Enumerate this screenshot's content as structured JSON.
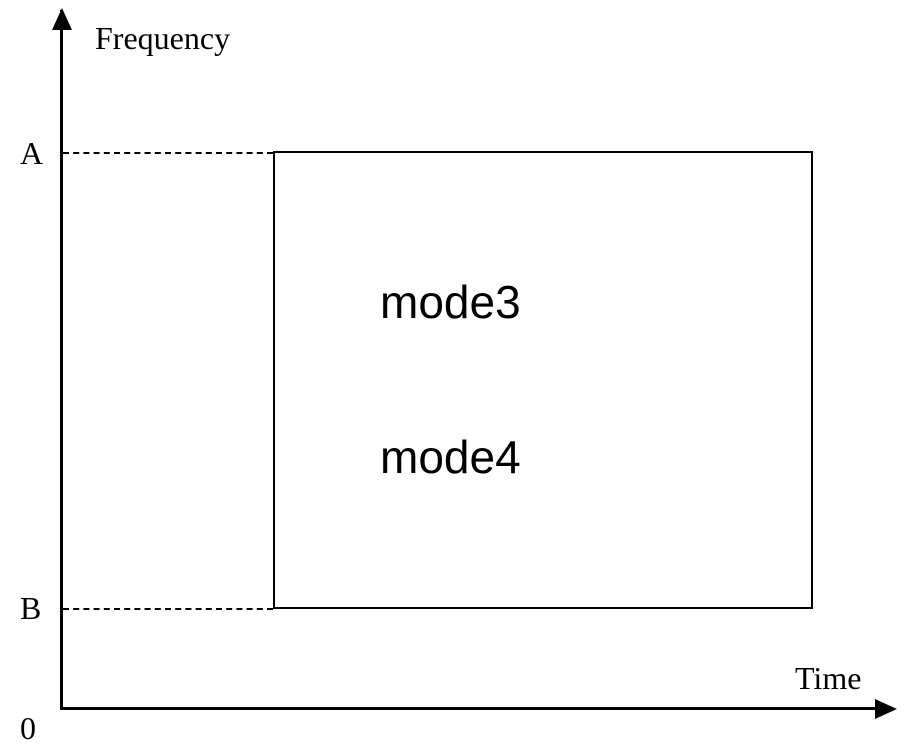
{
  "chart_data": {
    "type": "diagram",
    "title": "",
    "xlabel": "Time",
    "ylabel": "Frequency",
    "origin": "0",
    "y_ticks": [
      "A",
      "B"
    ],
    "box_contents": [
      "mode3",
      "mode4"
    ],
    "description": "Time-frequency resource block diagram showing a rectangular region between frequency levels A (high) and B (low), containing mode3 and mode4 allocations"
  },
  "labels": {
    "y_axis": "Frequency",
    "x_axis": "Time",
    "origin": "0",
    "tick_a": "A",
    "tick_b": "B",
    "mode3": "mode3",
    "mode4": "mode4"
  }
}
